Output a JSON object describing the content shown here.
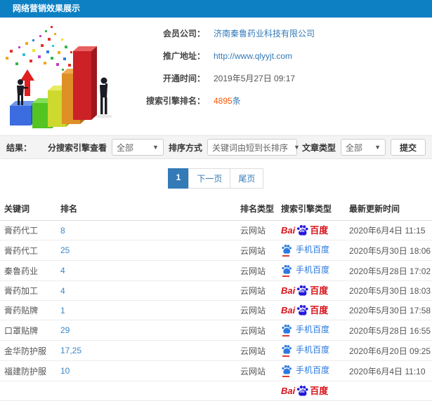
{
  "header": {
    "title": "网络营销效果展示"
  },
  "info": {
    "fields": [
      {
        "label": "会员公司：",
        "value": "济南秦鲁药业科技有限公司"
      },
      {
        "label": "推广地址：",
        "value": "http://www.qlyyjt.com"
      },
      {
        "label": "开通时间：",
        "value": "2019年5月27日 09:17"
      },
      {
        "label": "搜索引擎排名：",
        "value": "4895",
        "suffix": "条"
      }
    ]
  },
  "filters": {
    "result_label": "结果：",
    "engine_label": "分搜索引擎查看",
    "engine_value": "全部",
    "sort_label": "排序方式",
    "sort_value": "关键词由短到长排序",
    "article_label": "文章类型",
    "article_value": "全部",
    "caret": "▼",
    "submit_label": "提交"
  },
  "pagination": {
    "current": "1",
    "next_label": "下一页",
    "last_label": "尾页"
  },
  "logos": {
    "baidu": {
      "bai": "Bai",
      "du": "du",
      "cn": "百度"
    },
    "mobile": {
      "text": "手机百度"
    }
  },
  "table": {
    "headers": [
      "关键词",
      "排名",
      "排名类型",
      "搜索引擎类型",
      "最新更新时间"
    ],
    "rows": [
      {
        "keyword": "膏药代工",
        "rank": "8",
        "rank_type": "云网站",
        "engine": "baidu",
        "updated": "2020年6月4日 11:15"
      },
      {
        "keyword": "膏药代工",
        "rank": "25",
        "rank_type": "云网站",
        "engine": "mobile",
        "updated": "2020年5月30日 18:06"
      },
      {
        "keyword": "秦鲁药业",
        "rank": "4",
        "rank_type": "云网站",
        "engine": "mobile",
        "updated": "2020年5月28日 17:02"
      },
      {
        "keyword": "膏药加工",
        "rank": "4",
        "rank_type": "云网站",
        "engine": "baidu",
        "updated": "2020年5月30日 18:03"
      },
      {
        "keyword": "膏药贴牌",
        "rank": "1",
        "rank_type": "云网站",
        "engine": "baidu",
        "updated": "2020年5月30日 17:58"
      },
      {
        "keyword": "口罩贴牌",
        "rank": "29",
        "rank_type": "云网站",
        "engine": "mobile",
        "updated": "2020年5月28日 16:55"
      },
      {
        "keyword": "金华防护服",
        "rank": "17,25",
        "rank_type": "云网站",
        "engine": "mobile",
        "updated": "2020年6月20日 09:25"
      },
      {
        "keyword": "福建防护服",
        "rank": "10",
        "rank_type": "云网站",
        "engine": "mobile",
        "updated": "2020年6月4日 11:10"
      }
    ],
    "partial_row": {
      "engine": "baidu"
    }
  },
  "colors": {
    "header_blue": "#0d80c4",
    "link_blue": "#337ab7",
    "highlight_orange": "#ff5500",
    "baidu_red": "#d7121a",
    "baidu_blue": "#2319dc",
    "mobile_blue": "#2b7ae0"
  }
}
